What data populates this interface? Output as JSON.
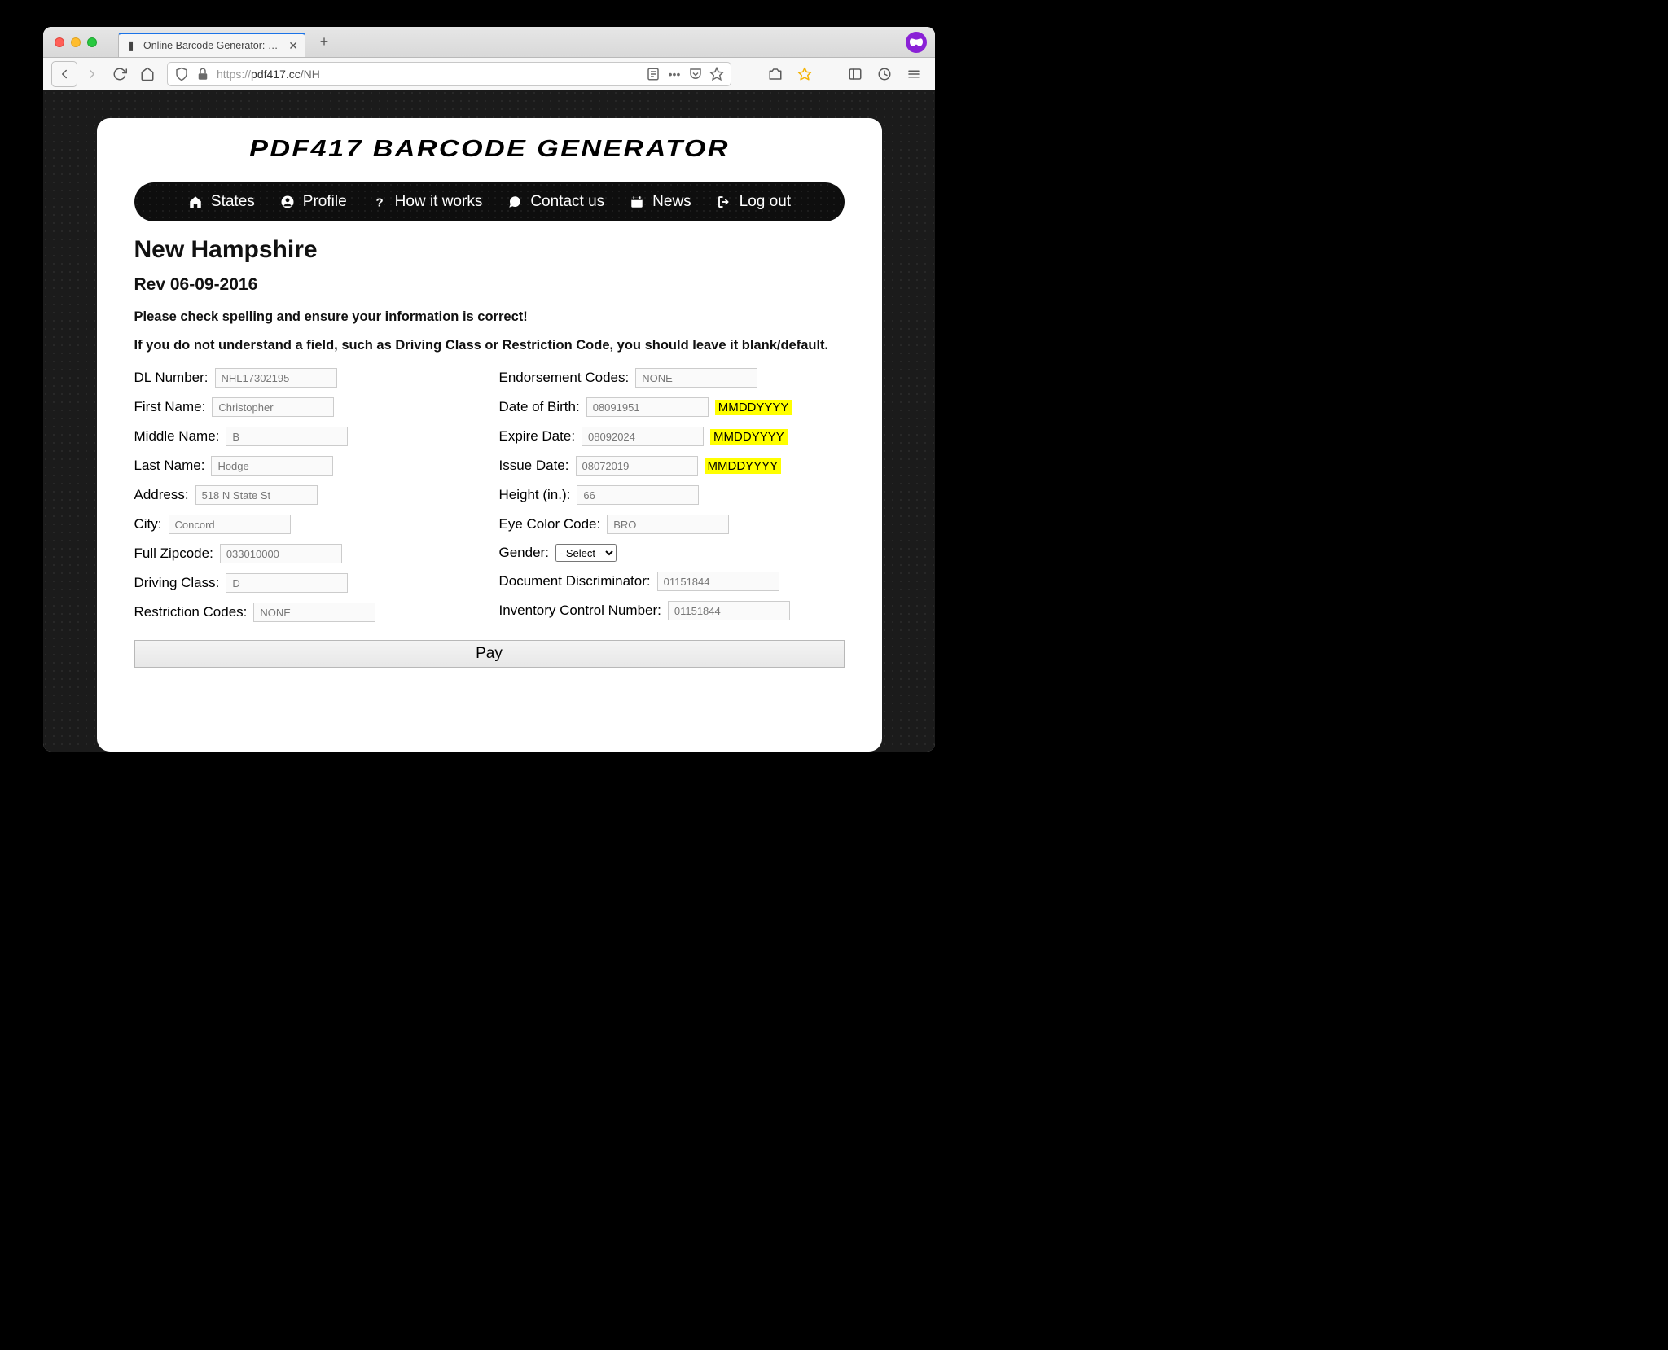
{
  "browser": {
    "tab_title": "Online Barcode Generator: PDF…",
    "url_proto": "https://",
    "url_host": "pdf417.cc",
    "url_path": "/NH",
    "newtab_label": "+"
  },
  "page": {
    "brand": "PDF417 BARCODE GENERATOR",
    "title": "New Hampshire",
    "rev": "Rev 06-09-2016",
    "warn1": "Please check spelling and ensure your information is correct!",
    "warn2": "If you do not understand a field, such as Driving Class or Restriction Code, you should leave it blank/default."
  },
  "nav": {
    "states": "States",
    "profile": "Profile",
    "how": "How it works",
    "contact": "Contact us",
    "news": "News",
    "logout": "Log out"
  },
  "labels": {
    "dl": "DL Number:",
    "first": "First Name:",
    "middle": "Middle Name:",
    "last": "Last Name:",
    "address": "Address:",
    "city": "City:",
    "zip": "Full Zipcode:",
    "class": "Driving Class:",
    "restrict": "Restriction Codes:",
    "endorse": "Endorsement Codes:",
    "dob": "Date of Birth:",
    "expire": "Expire Date:",
    "issue": "Issue Date:",
    "height": "Height (in.):",
    "eye": "Eye Color Code:",
    "gender": "Gender:",
    "docdisc": "Document Discriminator:",
    "inv": "Inventory Control Number:"
  },
  "values": {
    "dl": "NHL17302195",
    "first": "Christopher",
    "middle": "B",
    "last": "Hodge",
    "address": "518 N State St",
    "city": "Concord",
    "zip": "033010000",
    "class": "D",
    "restrict": "NONE",
    "endorse": "NONE",
    "dob": "08091951",
    "expire": "08092024",
    "issue": "08072019",
    "height": "66",
    "eye": "BRO",
    "gender_placeholder": "- Select -",
    "docdisc": "01151844",
    "inv": "01151844"
  },
  "hints": {
    "datefmt": "MMDDYYYY"
  },
  "buttons": {
    "pay": "Pay"
  }
}
